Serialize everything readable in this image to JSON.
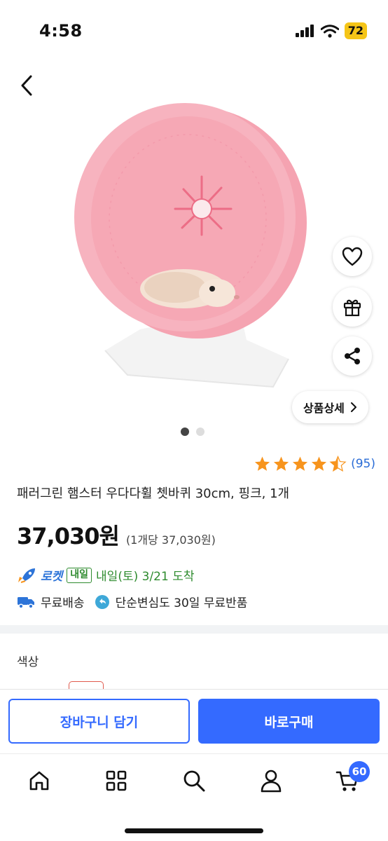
{
  "status_bar": {
    "time": "4:58",
    "battery": "72"
  },
  "product": {
    "title": "패러그린 햄스터 우다다휠 쳇바퀴 30cm, 핑크, 1개",
    "price": "37,030원",
    "unit_price": "(1개당 37,030원)",
    "rating": 4.5,
    "review_count": "(95)",
    "detail_button": "상품상세",
    "image_dots": {
      "count": 2,
      "active": 1
    }
  },
  "delivery": {
    "rocket_label": "로켓",
    "badge": "내일",
    "arrival": "내일(토) 3/21 도착"
  },
  "benefits": {
    "shipping": "무료배송",
    "returns": "단순변심도 30일 무료반품"
  },
  "option": {
    "label": "색상"
  },
  "actions": {
    "add_to_cart": "장바구니 담기",
    "buy_now": "바로구매"
  },
  "bottom_nav": {
    "cart_count": "60"
  },
  "colors": {
    "primary": "#346aff",
    "rating_star": "#f7941d",
    "arrival_green": "#2e8b2e",
    "wheel_pink": "#f6a9b6"
  },
  "icons": [
    "chevron-left-icon",
    "heart-icon",
    "gift-icon",
    "share-icon",
    "chevron-right-icon",
    "star-icon",
    "rocket-icon",
    "truck-icon",
    "return-icon",
    "home-icon",
    "category-icon",
    "search-icon",
    "user-icon",
    "cart-icon"
  ]
}
